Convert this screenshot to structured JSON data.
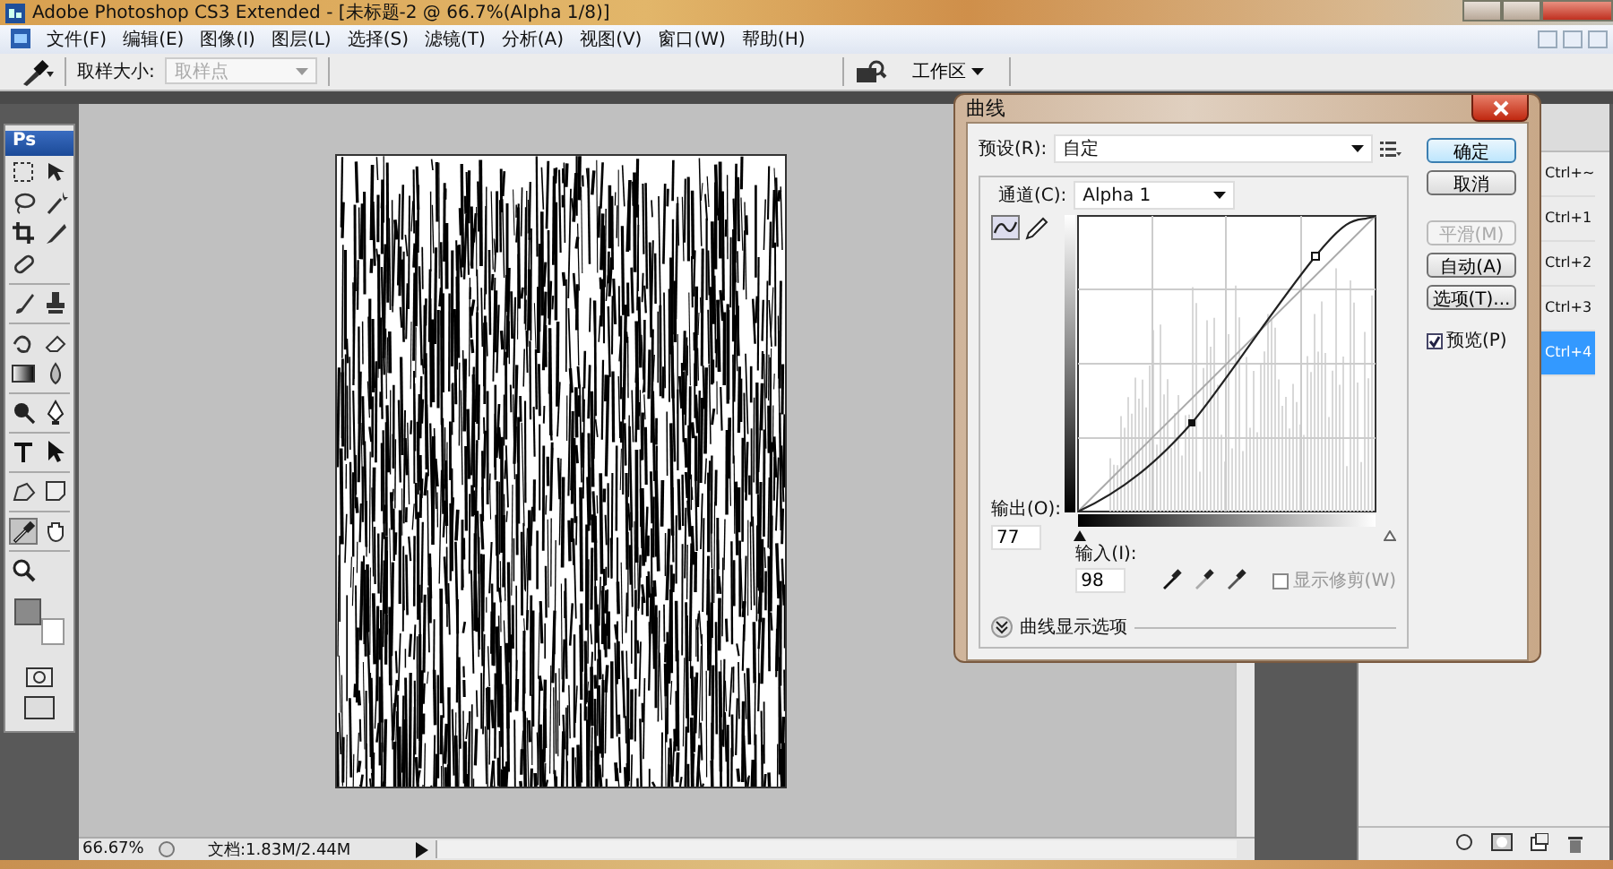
{
  "window": {
    "title": "Adobe Photoshop CS3 Extended - [未标题-2 @ 66.7%(Alpha 1/8)]"
  },
  "menu": [
    "文件(F)",
    "编辑(E)",
    "图像(I)",
    "图层(L)",
    "选择(S)",
    "滤镜(T)",
    "分析(A)",
    "视图(V)",
    "窗口(W)",
    "帮助(H)"
  ],
  "options_bar": {
    "sample_size_label": "取样大小:",
    "sample_size_value": "取样点",
    "workspace": "工作区"
  },
  "toolbox": {
    "logo": "Ps",
    "tools": [
      {
        "kind": "marquee",
        "selected": false
      },
      {
        "kind": "move",
        "selected": false
      },
      {
        "kind": "lasso",
        "selected": false
      },
      {
        "kind": "wand",
        "selected": false
      },
      {
        "kind": "crop",
        "selected": false
      },
      {
        "kind": "slice",
        "selected": false
      },
      {
        "kind": "healing",
        "selected": false
      },
      {
        "kind": "brush",
        "selected": false
      },
      {
        "kind": "stamp",
        "selected": false
      },
      {
        "kind": "history",
        "selected": false
      },
      {
        "kind": "eraser",
        "selected": false
      },
      {
        "kind": "gradient",
        "selected": false
      },
      {
        "kind": "blur",
        "selected": false
      },
      {
        "kind": "dodge",
        "selected": false
      },
      {
        "kind": "pen",
        "selected": false
      },
      {
        "kind": "type",
        "selected": false
      },
      {
        "kind": "select",
        "selected": false
      },
      {
        "kind": "shape",
        "selected": false
      },
      {
        "kind": "notes",
        "selected": false
      },
      {
        "kind": "eyedropper",
        "selected": true
      },
      {
        "kind": "hand",
        "selected": false
      },
      {
        "kind": "zoom",
        "selected": false
      }
    ]
  },
  "document": {
    "zoom": "66.67%",
    "doc_info": "文档:1.83M/2.44M"
  },
  "channels_panel": {
    "rows": [
      {
        "shortcut": "Ctrl+~",
        "selected": false
      },
      {
        "shortcut": "Ctrl+1",
        "selected": false
      },
      {
        "shortcut": "Ctrl+2",
        "selected": false
      },
      {
        "shortcut": "Ctrl+3",
        "selected": false
      },
      {
        "shortcut": "Ctrl+4",
        "selected": true
      }
    ]
  },
  "curves_dialog": {
    "title": "曲线",
    "preset_label": "预设(R):",
    "preset_value": "自定",
    "channel_label": "通道(C):",
    "channel_value": "Alpha 1",
    "curve_tools": [
      {
        "kind": "curve",
        "selected": true
      },
      {
        "kind": "pencil",
        "selected": false
      }
    ],
    "output_label": "输出(O):",
    "output_value": "77",
    "input_label": "输入(I):",
    "input_value": "98",
    "show_clipping": {
      "label": "显示修剪(W)",
      "checked": false,
      "disabled": true
    },
    "display_options": "曲线显示选项",
    "buttons": [
      {
        "label": "确定",
        "default": true,
        "disabled": false
      },
      {
        "label": "取消",
        "default": false,
        "disabled": false
      },
      {
        "label": "平滑(M)",
        "default": false,
        "disabled": true
      },
      {
        "label": "自动(A)",
        "default": false,
        "disabled": false
      },
      {
        "label": "选项(T)...",
        "default": false,
        "disabled": false
      }
    ],
    "preview": {
      "label": "预览(P)",
      "checked": true
    }
  }
}
